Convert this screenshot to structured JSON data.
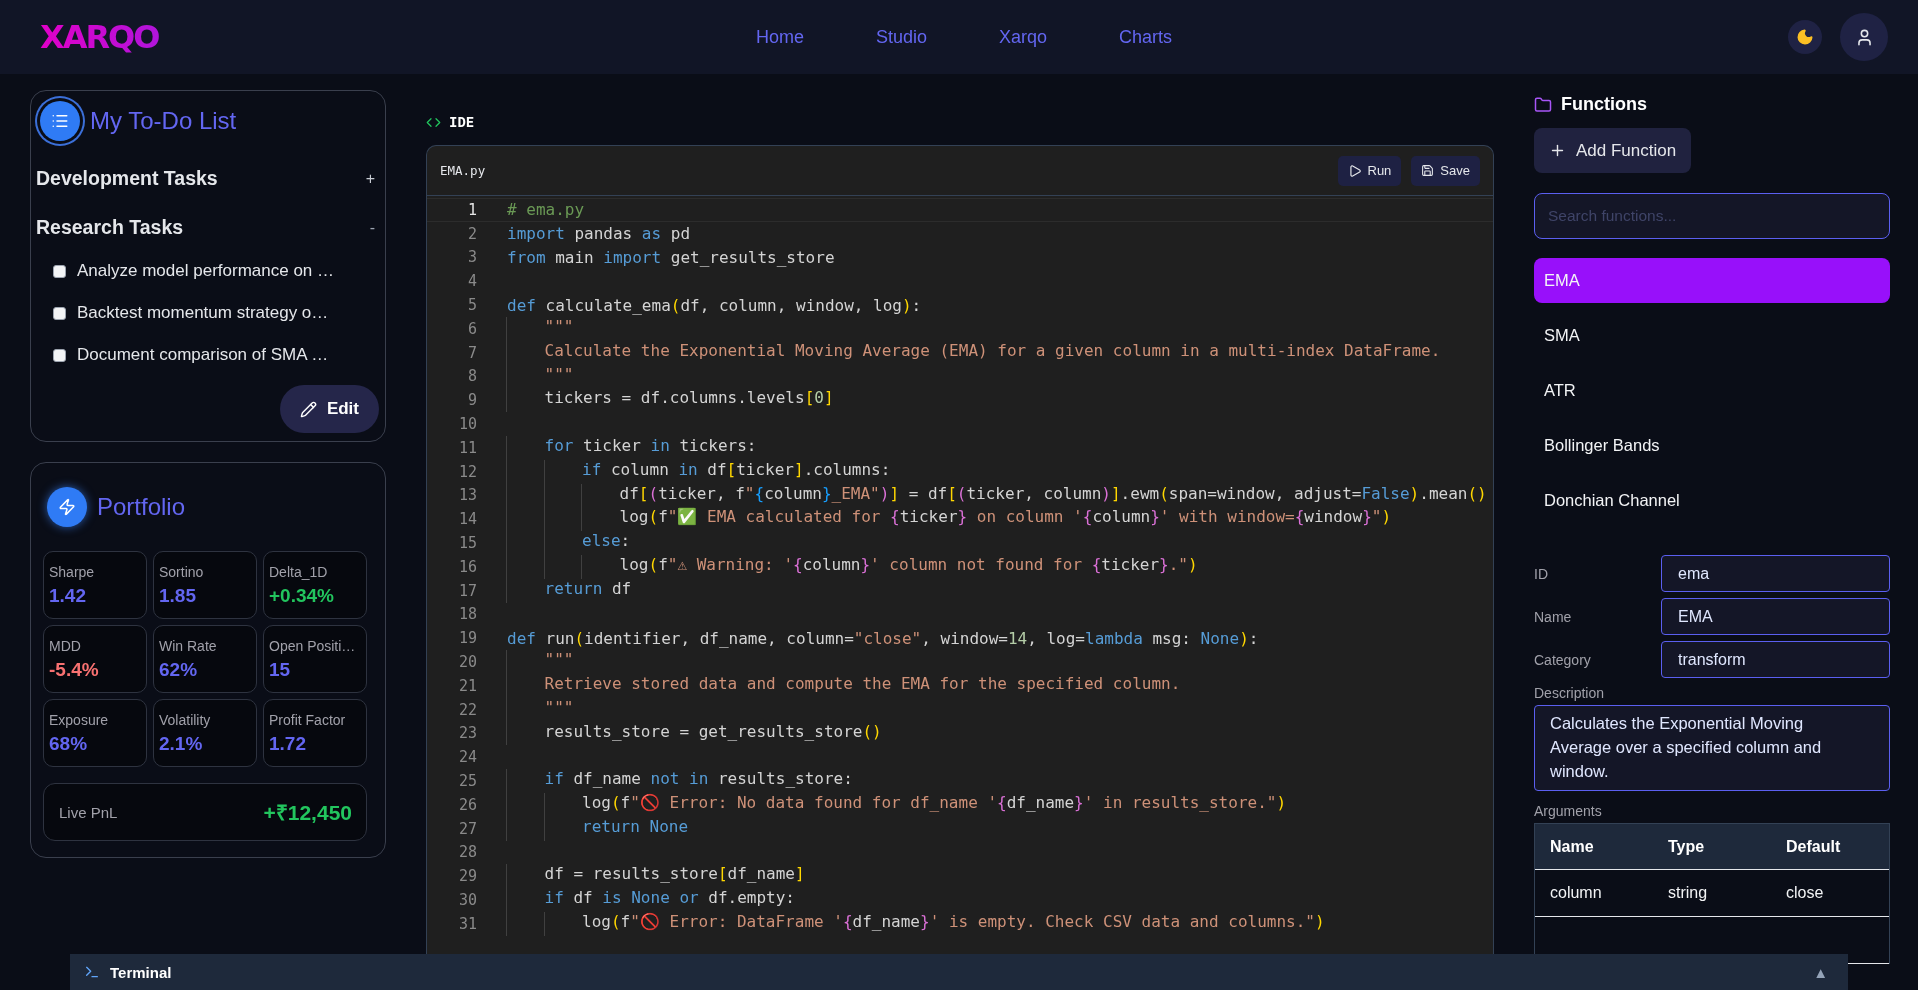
{
  "header": {
    "logo": "XARQO",
    "nav": [
      {
        "label": "Home"
      },
      {
        "label": "Studio"
      },
      {
        "label": "Xarqo"
      },
      {
        "label": "Charts"
      }
    ]
  },
  "todo": {
    "title": "My To-Do List",
    "sections": [
      {
        "title": "Development Tasks",
        "toggle": "+",
        "expanded": false
      },
      {
        "title": "Research Tasks",
        "toggle": "-",
        "expanded": true,
        "tasks": [
          {
            "text": "Analyze model performance on …",
            "checked": false
          },
          {
            "text": "Backtest momentum strategy o…",
            "checked": false
          },
          {
            "text": "Document comparison of SMA …",
            "checked": false
          }
        ]
      }
    ],
    "edit_button": "Edit"
  },
  "portfolio": {
    "title": "Portfolio",
    "metrics": [
      {
        "label": "Sharpe",
        "value": "1.42",
        "color": "#6366f1"
      },
      {
        "label": "Sortino",
        "value": "1.85",
        "color": "#6366f1"
      },
      {
        "label": "Delta_1D",
        "value": "+0.34%",
        "color": "#22c55e"
      },
      {
        "label": "MDD",
        "value": "-5.4%",
        "color": "#f87171"
      },
      {
        "label": "Win Rate",
        "value": "62%",
        "color": "#6366f1"
      },
      {
        "label": "Open Positi…",
        "value": "15",
        "color": "#6366f1"
      },
      {
        "label": "Exposure",
        "value": "68%",
        "color": "#6366f1"
      },
      {
        "label": "Volatility",
        "value": "2.1%",
        "color": "#6366f1"
      },
      {
        "label": "Profit Factor",
        "value": "1.72",
        "color": "#6366f1"
      }
    ],
    "live_pnl": {
      "label": "Live PnL",
      "value": "+₹12,450",
      "color": "#22c55e"
    }
  },
  "ide": {
    "title": "IDE",
    "file": "EMA.py",
    "buttons": [
      {
        "label": "Run",
        "kind": "run"
      },
      {
        "label": "Save",
        "kind": "save"
      }
    ],
    "lines": [
      {
        "number": "1",
        "current": true,
        "tokens": [
          {
            "kind": "comment",
            "text": "# ema.py"
          }
        ]
      },
      {
        "number": "2",
        "current": false,
        "tokens": [
          {
            "kind": "keyword",
            "text": "import"
          },
          {
            "kind": "plain",
            "text": " pandas "
          },
          {
            "kind": "keyword",
            "text": "as"
          },
          {
            "kind": "plain",
            "text": " pd"
          }
        ]
      },
      {
        "number": "3",
        "current": false,
        "tokens": [
          {
            "kind": "keyword",
            "text": "from"
          },
          {
            "kind": "plain",
            "text": " main "
          },
          {
            "kind": "keyword",
            "text": "import"
          },
          {
            "kind": "plain",
            "text": " get_results_store"
          }
        ]
      },
      {
        "number": "4",
        "current": false
      },
      {
        "number": "5",
        "current": false,
        "tokens": [
          {
            "kind": "keyword",
            "text": "def"
          },
          {
            "kind": "plain",
            "text": " calculate_ema"
          },
          {
            "kind": "bracket1",
            "text": "("
          },
          {
            "kind": "plain",
            "text": "df, column, window, log"
          },
          {
            "kind": "bracket1",
            "text": ")"
          },
          {
            "kind": "plain",
            "text": ":"
          }
        ]
      },
      {
        "number": "6",
        "current": false,
        "tokens": [
          {
            "kind": "string",
            "text": "    \"\"\""
          }
        ]
      },
      {
        "number": "7",
        "current": false,
        "tokens": [
          {
            "kind": "string",
            "text": "    Calculate the Exponential Moving Average (EMA) for a given column in a multi-index DataFrame."
          }
        ]
      },
      {
        "number": "8",
        "current": false,
        "tokens": [
          {
            "kind": "string",
            "text": "    \"\"\""
          }
        ]
      },
      {
        "number": "9",
        "current": false,
        "tokens": [
          {
            "kind": "plain",
            "text": "    tickers = df.columns.levels"
          },
          {
            "kind": "bracket1",
            "text": "["
          },
          {
            "kind": "number",
            "text": "0"
          },
          {
            "kind": "bracket1",
            "text": "]"
          }
        ]
      },
      {
        "number": "10",
        "current": false
      },
      {
        "number": "11",
        "current": false,
        "tokens": [
          {
            "kind": "keyword",
            "text": "    for"
          },
          {
            "kind": "plain",
            "text": " ticker "
          },
          {
            "kind": "keyword",
            "text": "in"
          },
          {
            "kind": "plain",
            "text": " tickers:"
          }
        ]
      },
      {
        "number": "12",
        "current": false,
        "tokens": [
          {
            "kind": "keyword",
            "text": "        if"
          },
          {
            "kind": "plain",
            "text": " column "
          },
          {
            "kind": "keyword",
            "text": "in"
          },
          {
            "kind": "plain",
            "text": " df"
          },
          {
            "kind": "bracket1",
            "text": "["
          },
          {
            "kind": "plain",
            "text": "ticker"
          },
          {
            "kind": "bracket1",
            "text": "]"
          },
          {
            "kind": "plain",
            "text": ".columns:"
          }
        ]
      },
      {
        "number": "13",
        "current": false,
        "tokens": [
          {
            "kind": "plain",
            "text": "            df"
          },
          {
            "kind": "bracket1",
            "text": "["
          },
          {
            "kind": "bracket2",
            "text": "("
          },
          {
            "kind": "plain",
            "text": "ticker, f"
          },
          {
            "kind": "string",
            "text": "\""
          },
          {
            "kind": "bracket3",
            "text": "{"
          },
          {
            "kind": "plain",
            "text": "column"
          },
          {
            "kind": "bracket3",
            "text": "}"
          },
          {
            "kind": "string",
            "text": "_EMA\""
          },
          {
            "kind": "bracket2",
            "text": ")"
          },
          {
            "kind": "bracket1",
            "text": "]"
          },
          {
            "kind": "plain",
            "text": " = df"
          },
          {
            "kind": "bracket1",
            "text": "["
          },
          {
            "kind": "bracket2",
            "text": "("
          },
          {
            "kind": "plain",
            "text": "ticker, column"
          },
          {
            "kind": "bracket2",
            "text": ")"
          },
          {
            "kind": "bracket1",
            "text": "]"
          },
          {
            "kind": "plain",
            "text": ".ewm"
          },
          {
            "kind": "bracket1",
            "text": "("
          },
          {
            "kind": "plain",
            "text": "span=window, adjust="
          },
          {
            "kind": "keyword",
            "text": "False"
          },
          {
            "kind": "bracket1",
            "text": ")"
          },
          {
            "kind": "plain",
            "text": ".mean"
          },
          {
            "kind": "bracket1",
            "text": "()"
          }
        ]
      },
      {
        "number": "14",
        "current": false,
        "tokens": [
          {
            "kind": "plain",
            "text": "            log"
          },
          {
            "kind": "bracket1",
            "text": "("
          },
          {
            "kind": "plain",
            "text": "f"
          },
          {
            "kind": "string",
            "text": "\"✅ EMA calculated for "
          },
          {
            "kind": "bracket2",
            "text": "{"
          },
          {
            "kind": "plain",
            "text": "ticker"
          },
          {
            "kind": "bracket2",
            "text": "}"
          },
          {
            "kind": "string",
            "text": " on column '"
          },
          {
            "kind": "bracket2",
            "text": "{"
          },
          {
            "kind": "plain",
            "text": "column"
          },
          {
            "kind": "bracket2",
            "text": "}"
          },
          {
            "kind": "string",
            "text": "' with window="
          },
          {
            "kind": "bracket2",
            "text": "{"
          },
          {
            "kind": "plain",
            "text": "window"
          },
          {
            "kind": "bracket2",
            "text": "}"
          },
          {
            "kind": "string",
            "text": "\""
          },
          {
            "kind": "bracket1",
            "text": ")"
          }
        ]
      },
      {
        "number": "15",
        "current": false,
        "tokens": [
          {
            "kind": "keyword",
            "text": "        else"
          },
          {
            "kind": "plain",
            "text": ":"
          }
        ]
      },
      {
        "number": "16",
        "current": false,
        "tokens": [
          {
            "kind": "plain",
            "text": "            log"
          },
          {
            "kind": "bracket1",
            "text": "("
          },
          {
            "kind": "plain",
            "text": "f"
          },
          {
            "kind": "string",
            "text": "\"⚠ Warning: '"
          },
          {
            "kind": "bracket2",
            "text": "{"
          },
          {
            "kind": "plain",
            "text": "column"
          },
          {
            "kind": "bracket2",
            "text": "}"
          },
          {
            "kind": "string",
            "text": "' column not found for "
          },
          {
            "kind": "bracket2",
            "text": "{"
          },
          {
            "kind": "plain",
            "text": "ticker"
          },
          {
            "kind": "bracket2",
            "text": "}"
          },
          {
            "kind": "string",
            "text": ".\""
          },
          {
            "kind": "bracket1",
            "text": ")"
          }
        ]
      },
      {
        "number": "17",
        "current": false,
        "tokens": [
          {
            "kind": "keyword",
            "text": "    return"
          },
          {
            "kind": "plain",
            "text": " df"
          }
        ]
      },
      {
        "number": "18",
        "current": false
      },
      {
        "number": "19",
        "current": false,
        "tokens": [
          {
            "kind": "keyword",
            "text": "def"
          },
          {
            "kind": "plain",
            "text": " run"
          },
          {
            "kind": "bracket1",
            "text": "("
          },
          {
            "kind": "plain",
            "text": "identifier, df_name, column="
          },
          {
            "kind": "string",
            "text": "\"close\""
          },
          {
            "kind": "plain",
            "text": ", window="
          },
          {
            "kind": "number",
            "text": "14"
          },
          {
            "kind": "plain",
            "text": ", log="
          },
          {
            "kind": "keyword",
            "text": "lambda"
          },
          {
            "kind": "plain",
            "text": " msg: "
          },
          {
            "kind": "keyword",
            "text": "None"
          },
          {
            "kind": "bracket1",
            "text": ")"
          },
          {
            "kind": "plain",
            "text": ":"
          }
        ]
      },
      {
        "number": "20",
        "current": false,
        "tokens": [
          {
            "kind": "string",
            "text": "    \"\"\""
          }
        ]
      },
      {
        "number": "21",
        "current": false,
        "tokens": [
          {
            "kind": "string",
            "text": "    Retrieve stored data and compute the EMA for the specified column."
          }
        ]
      },
      {
        "number": "22",
        "current": false,
        "tokens": [
          {
            "kind": "string",
            "text": "    \"\"\""
          }
        ]
      },
      {
        "number": "23",
        "current": false,
        "tokens": [
          {
            "kind": "plain",
            "text": "    results_store = get_results_store"
          },
          {
            "kind": "bracket1",
            "text": "()"
          }
        ]
      },
      {
        "number": "24",
        "current": false
      },
      {
        "number": "25",
        "current": false,
        "tokens": [
          {
            "kind": "keyword",
            "text": "    if"
          },
          {
            "kind": "plain",
            "text": " df_name "
          },
          {
            "kind": "keyword",
            "text": "not"
          },
          {
            "kind": "keyword",
            "text": " in"
          },
          {
            "kind": "plain",
            "text": " results_store:"
          }
        ]
      },
      {
        "number": "26",
        "current": false,
        "tokens": [
          {
            "kind": "plain",
            "text": "        log"
          },
          {
            "kind": "bracket1",
            "text": "("
          },
          {
            "kind": "plain",
            "text": "f"
          },
          {
            "kind": "string",
            "text": "\"🚫 Error: No data found for df_name '"
          },
          {
            "kind": "bracket2",
            "text": "{"
          },
          {
            "kind": "plain",
            "text": "df_name"
          },
          {
            "kind": "bracket2",
            "text": "}"
          },
          {
            "kind": "string",
            "text": "' in results_store.\""
          },
          {
            "kind": "bracket1",
            "text": ")"
          }
        ]
      },
      {
        "number": "27",
        "current": false,
        "tokens": [
          {
            "kind": "keyword",
            "text": "        return"
          },
          {
            "kind": "keyword",
            "text": " None"
          }
        ]
      },
      {
        "number": "28",
        "current": false
      },
      {
        "number": "29",
        "current": false,
        "tokens": [
          {
            "kind": "plain",
            "text": "    df = results_store"
          },
          {
            "kind": "bracket1",
            "text": "["
          },
          {
            "kind": "plain",
            "text": "df_name"
          },
          {
            "kind": "bracket1",
            "text": "]"
          }
        ]
      },
      {
        "number": "30",
        "current": false,
        "tokens": [
          {
            "kind": "keyword",
            "text": "    if"
          },
          {
            "kind": "plain",
            "text": " df "
          },
          {
            "kind": "keyword",
            "text": "is"
          },
          {
            "kind": "keyword",
            "text": " None"
          },
          {
            "kind": "keyword",
            "text": " or"
          },
          {
            "kind": "plain",
            "text": " df.empty:"
          }
        ]
      },
      {
        "number": "31",
        "current": false,
        "tokens": [
          {
            "kind": "plain",
            "text": "        log"
          },
          {
            "kind": "bracket1",
            "text": "("
          },
          {
            "kind": "plain",
            "text": "f"
          },
          {
            "kind": "string",
            "text": "\"🚫 Error: DataFrame '"
          },
          {
            "kind": "bracket2",
            "text": "{"
          },
          {
            "kind": "plain",
            "text": "df_name"
          },
          {
            "kind": "bracket2",
            "text": "}"
          },
          {
            "kind": "string",
            "text": "' is empty. Check CSV data and columns.\""
          },
          {
            "kind": "bracket1",
            "text": ")"
          }
        ]
      }
    ]
  },
  "functions": {
    "title": "Functions",
    "add_button": "Add Function",
    "search": {
      "placeholder": "Search functions..."
    },
    "items": [
      {
        "label": "EMA",
        "selected": true
      },
      {
        "label": "SMA",
        "selected": false
      },
      {
        "label": "ATR",
        "selected": false
      },
      {
        "label": "Bollinger Bands",
        "selected": false
      },
      {
        "label": "Donchian Channel",
        "selected": false
      }
    ],
    "fields": [
      {
        "label": "ID",
        "value": "ema"
      },
      {
        "label": "Name",
        "value": "EMA"
      },
      {
        "label": "Category",
        "value": "transform"
      }
    ],
    "description": {
      "label": "Description",
      "value": "Calculates the Exponential Moving Average over a specified column and window."
    },
    "arguments": {
      "label": "Arguments",
      "columns": [
        "Name",
        "Type",
        "Default"
      ],
      "rows": [
        [
          "column",
          "string",
          "close"
        ]
      ]
    }
  },
  "terminal": {
    "title": "Terminal",
    "toggle": "▲"
  }
}
